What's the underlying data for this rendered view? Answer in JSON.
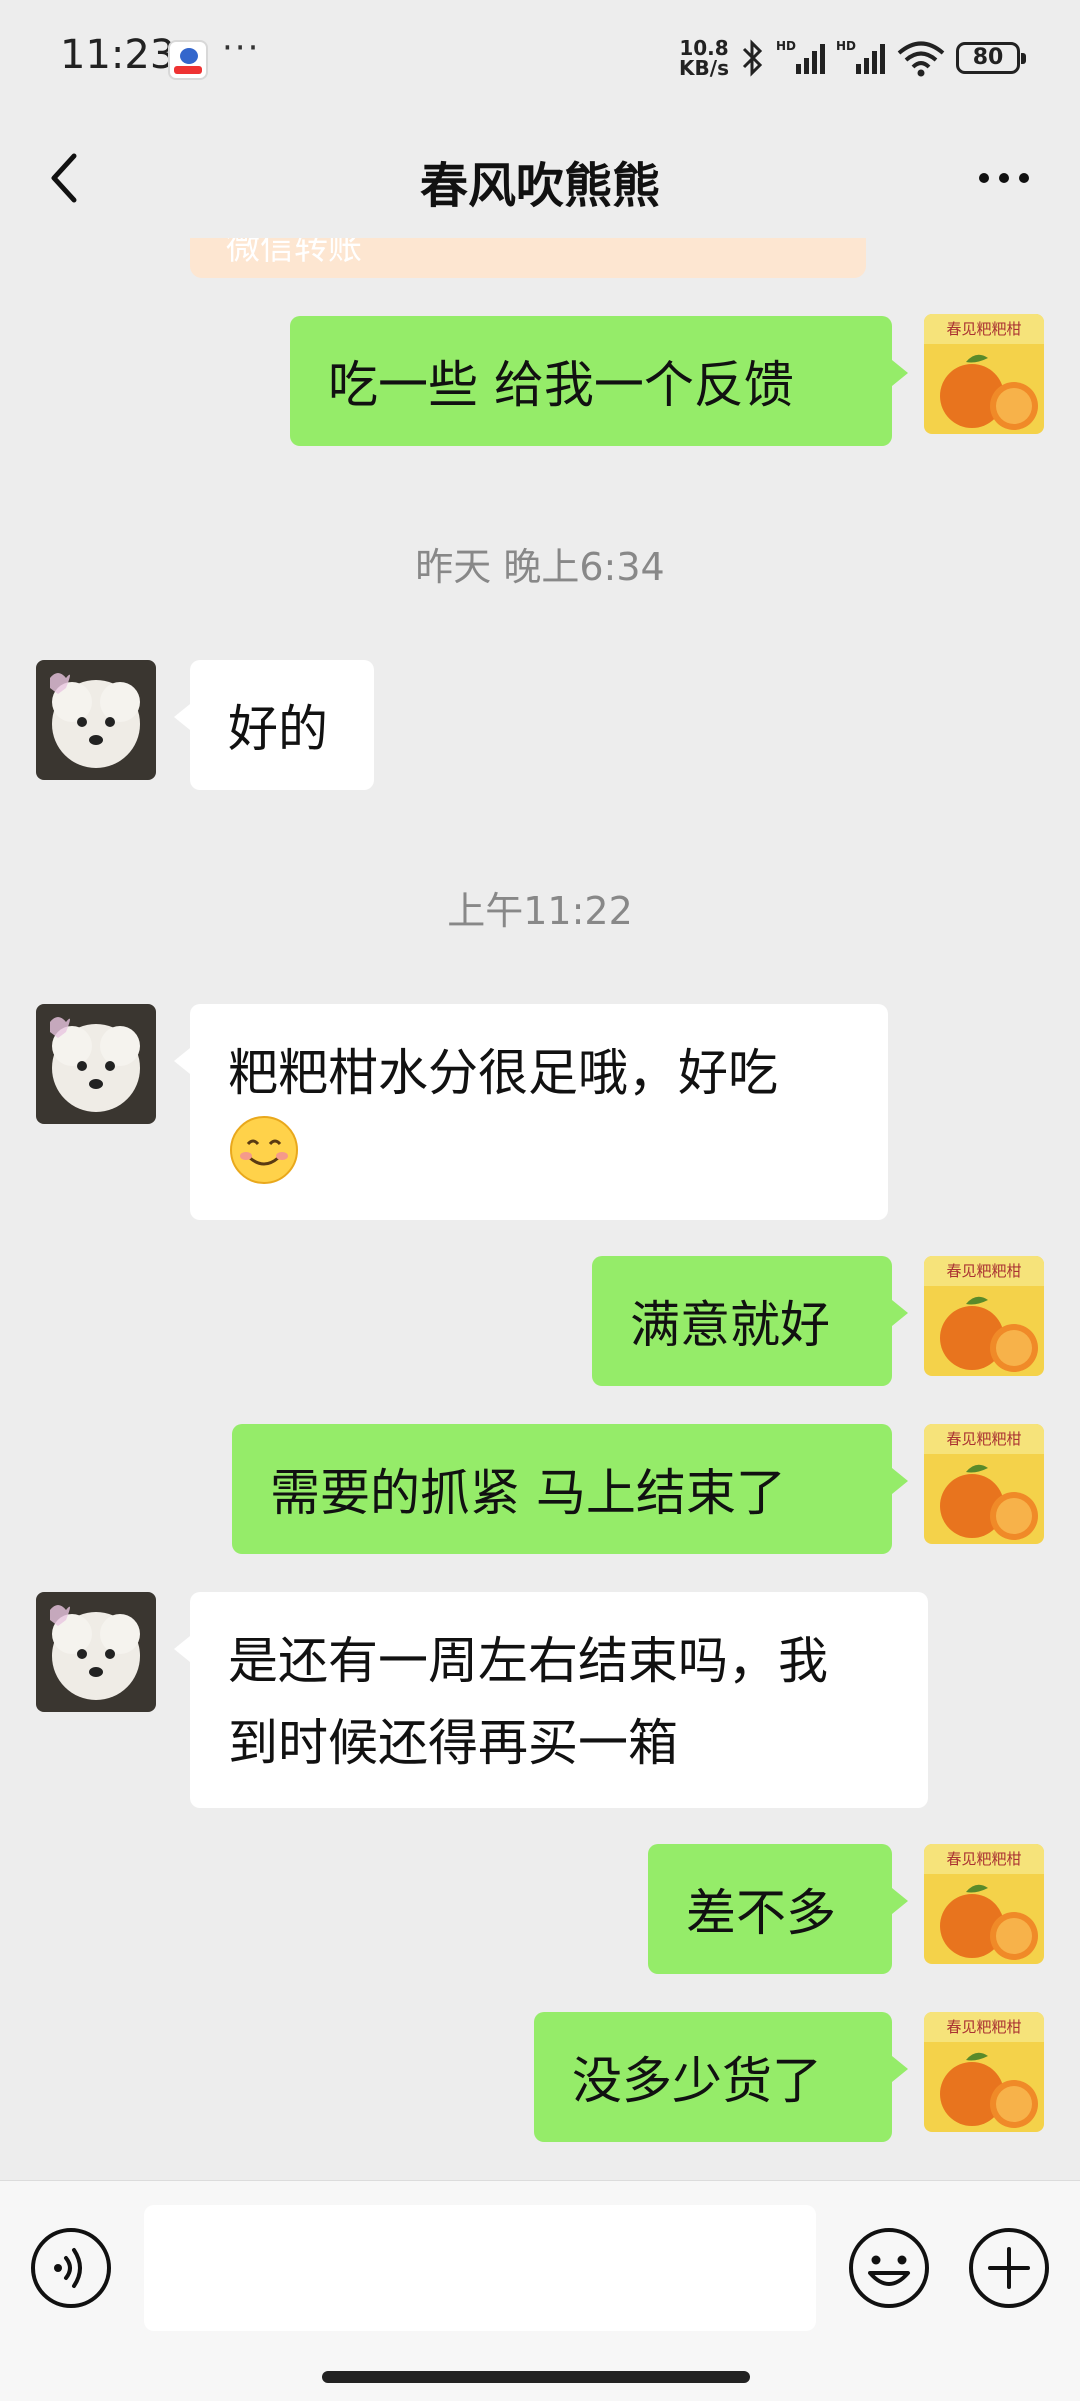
{
  "status_bar": {
    "time": "11:23",
    "dots": "···",
    "network_speed_value": "10.8",
    "network_speed_unit": "KB/s",
    "battery": "80",
    "icons": [
      "baidu-app-icon",
      "bluetooth-icon",
      "signal-hd-icon",
      "signal-hd-icon",
      "wifi-icon",
      "battery-icon"
    ]
  },
  "header": {
    "title": "春风吹熊熊"
  },
  "partial_card_text": "微信转账",
  "messages": [
    {
      "side": "out",
      "text": "吃一些 给我一个反馈"
    },
    {
      "type": "time",
      "text": "昨天 晚上6:34"
    },
    {
      "side": "in",
      "text": "好的"
    },
    {
      "type": "time",
      "text": "上午11:22"
    },
    {
      "side": "in",
      "text": "粑粑柑水分很足哦，好吃",
      "emoji": "smile-emoji"
    },
    {
      "side": "out",
      "text": "满意就好"
    },
    {
      "side": "out",
      "text": "需要的抓紧 马上结束了"
    },
    {
      "side": "in",
      "text_line1": "是还有一周左右结束吗，我",
      "text_line2": "到时候还得再买一箱"
    },
    {
      "side": "out",
      "text": "差不多"
    },
    {
      "side": "out",
      "text": "没多少货了"
    }
  ],
  "avatars": {
    "self": {
      "label": "春见粑粑柑",
      "desc": "orange-fruit"
    },
    "other": {
      "desc": "white-dog"
    }
  },
  "input": {
    "value": "",
    "placeholder": ""
  },
  "colors": {
    "background": "#ededed",
    "outgoing_bubble": "#95ec69",
    "incoming_bubble": "#ffffff",
    "timestamp": "#888888"
  }
}
